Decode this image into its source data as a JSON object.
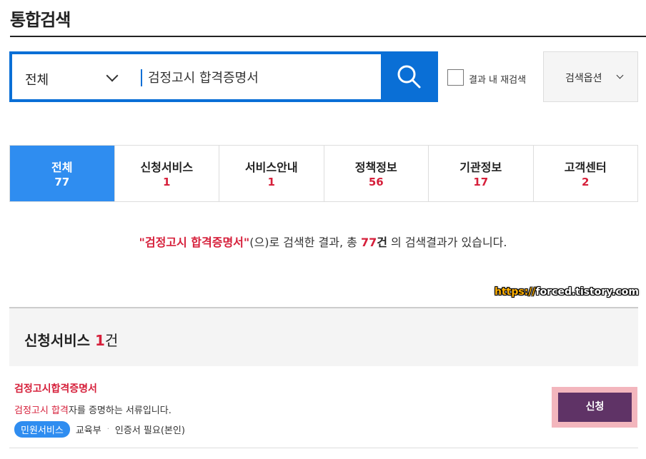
{
  "page_title": "통합검색",
  "search": {
    "scope": "전체",
    "query": "검정고시 합격증명서",
    "refine_label": "결과 내 재검색",
    "options_label": "검색옵션"
  },
  "tabs": [
    {
      "label": "전체",
      "count": "77",
      "active": true
    },
    {
      "label": "신청서비스",
      "count": "1"
    },
    {
      "label": "서비스안내",
      "count": "1"
    },
    {
      "label": "정책정보",
      "count": "56"
    },
    {
      "label": "기관정보",
      "count": "17"
    },
    {
      "label": "고객센터",
      "count": "2"
    }
  ],
  "summary": {
    "keyword": "\"검정고시 합격증명서\"",
    "text1": "(으)로 검색한 결과, 총 ",
    "count": "77",
    "unit": "건",
    "text2": " 의 검색결과가 있습니다."
  },
  "watermark": {
    "prefix": "https://",
    "rest": "forced.tistory.com"
  },
  "section": {
    "title": "신청서비스",
    "count": "1",
    "unit": "건"
  },
  "result": {
    "title": "검정고시합격증명서",
    "desc_highlight": "검정고시 합격",
    "desc_rest": "자를 증명하는 서류입니다.",
    "badge": "민원서비스",
    "agency": "교육부",
    "separator": "·",
    "auth": "인증서 필요(본인)",
    "apply_label": "신청"
  },
  "colors": {
    "search_blue": "#0a6fd6",
    "tab_active": "#2f8df0",
    "highlight_red": "#d6203b",
    "apply_purple": "#5f3366"
  }
}
